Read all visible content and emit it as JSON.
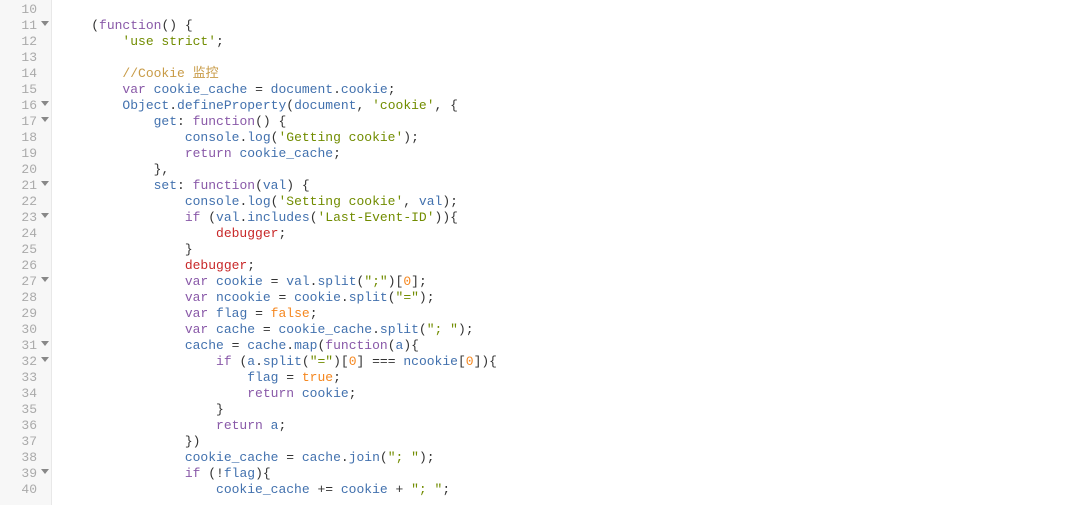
{
  "gutter": {
    "start": 10,
    "end": 40,
    "folds": [
      11,
      16,
      17,
      21,
      23,
      27,
      31,
      32,
      39
    ]
  },
  "indent_unit": "    ",
  "lines": [
    {
      "n": 10,
      "i": 0,
      "t": []
    },
    {
      "n": 11,
      "i": 1,
      "t": [
        {
          "c": "pun",
          "s": "("
        },
        {
          "c": "kw",
          "s": "function"
        },
        {
          "c": "pun",
          "s": "() {"
        }
      ]
    },
    {
      "n": 12,
      "i": 2,
      "t": [
        {
          "c": "str",
          "s": "'use strict'"
        },
        {
          "c": "pun",
          "s": ";"
        }
      ]
    },
    {
      "n": 13,
      "i": 0,
      "t": []
    },
    {
      "n": 14,
      "i": 2,
      "t": [
        {
          "c": "cmt",
          "s": "//Cookie 监控"
        }
      ]
    },
    {
      "n": 15,
      "i": 2,
      "t": [
        {
          "c": "kw",
          "s": "var"
        },
        {
          "c": "pun",
          "s": " "
        },
        {
          "c": "ident",
          "s": "cookie_cache"
        },
        {
          "c": "pun",
          "s": " = "
        },
        {
          "c": "ident",
          "s": "document"
        },
        {
          "c": "pun",
          "s": "."
        },
        {
          "c": "ident",
          "s": "cookie"
        },
        {
          "c": "pun",
          "s": ";"
        }
      ]
    },
    {
      "n": 16,
      "i": 2,
      "t": [
        {
          "c": "ident",
          "s": "Object"
        },
        {
          "c": "pun",
          "s": "."
        },
        {
          "c": "ident",
          "s": "defineProperty"
        },
        {
          "c": "pun",
          "s": "("
        },
        {
          "c": "ident",
          "s": "document"
        },
        {
          "c": "pun",
          "s": ", "
        },
        {
          "c": "str",
          "s": "'cookie'"
        },
        {
          "c": "pun",
          "s": ", {"
        }
      ]
    },
    {
      "n": 17,
      "i": 3,
      "t": [
        {
          "c": "ident",
          "s": "get"
        },
        {
          "c": "pun",
          "s": ": "
        },
        {
          "c": "kw",
          "s": "function"
        },
        {
          "c": "pun",
          "s": "() {"
        }
      ]
    },
    {
      "n": 18,
      "i": 4,
      "t": [
        {
          "c": "ident",
          "s": "console"
        },
        {
          "c": "pun",
          "s": "."
        },
        {
          "c": "ident",
          "s": "log"
        },
        {
          "c": "pun",
          "s": "("
        },
        {
          "c": "str",
          "s": "'Getting cookie'"
        },
        {
          "c": "pun",
          "s": ");"
        }
      ]
    },
    {
      "n": 19,
      "i": 4,
      "t": [
        {
          "c": "kw",
          "s": "return"
        },
        {
          "c": "pun",
          "s": " "
        },
        {
          "c": "ident",
          "s": "cookie_cache"
        },
        {
          "c": "pun",
          "s": ";"
        }
      ]
    },
    {
      "n": 20,
      "i": 3,
      "t": [
        {
          "c": "pun",
          "s": "},"
        }
      ]
    },
    {
      "n": 21,
      "i": 3,
      "t": [
        {
          "c": "ident",
          "s": "set"
        },
        {
          "c": "pun",
          "s": ": "
        },
        {
          "c": "kw",
          "s": "function"
        },
        {
          "c": "pun",
          "s": "("
        },
        {
          "c": "ident",
          "s": "val"
        },
        {
          "c": "pun",
          "s": ") {"
        }
      ]
    },
    {
      "n": 22,
      "i": 4,
      "t": [
        {
          "c": "ident",
          "s": "console"
        },
        {
          "c": "pun",
          "s": "."
        },
        {
          "c": "ident",
          "s": "log"
        },
        {
          "c": "pun",
          "s": "("
        },
        {
          "c": "str",
          "s": "'Setting cookie'"
        },
        {
          "c": "pun",
          "s": ", "
        },
        {
          "c": "ident",
          "s": "val"
        },
        {
          "c": "pun",
          "s": ");"
        }
      ]
    },
    {
      "n": 23,
      "i": 4,
      "t": [
        {
          "c": "kw",
          "s": "if"
        },
        {
          "c": "pun",
          "s": " ("
        },
        {
          "c": "ident",
          "s": "val"
        },
        {
          "c": "pun",
          "s": "."
        },
        {
          "c": "ident",
          "s": "includes"
        },
        {
          "c": "pun",
          "s": "("
        },
        {
          "c": "str",
          "s": "'Last-Event-ID'"
        },
        {
          "c": "pun",
          "s": ")){"
        }
      ]
    },
    {
      "n": 24,
      "i": 5,
      "t": [
        {
          "c": "dbg",
          "s": "debugger"
        },
        {
          "c": "pun",
          "s": ";"
        }
      ]
    },
    {
      "n": 25,
      "i": 4,
      "t": [
        {
          "c": "pun",
          "s": "}"
        }
      ]
    },
    {
      "n": 26,
      "i": 4,
      "t": [
        {
          "c": "dbg",
          "s": "debugger"
        },
        {
          "c": "pun",
          "s": ";"
        }
      ]
    },
    {
      "n": 27,
      "i": 4,
      "t": [
        {
          "c": "kw",
          "s": "var"
        },
        {
          "c": "pun",
          "s": " "
        },
        {
          "c": "ident",
          "s": "cookie"
        },
        {
          "c": "pun",
          "s": " = "
        },
        {
          "c": "ident",
          "s": "val"
        },
        {
          "c": "pun",
          "s": "."
        },
        {
          "c": "ident",
          "s": "split"
        },
        {
          "c": "pun",
          "s": "("
        },
        {
          "c": "str",
          "s": "\";\""
        },
        {
          "c": "pun",
          "s": ")["
        },
        {
          "c": "num",
          "s": "0"
        },
        {
          "c": "pun",
          "s": "];"
        }
      ]
    },
    {
      "n": 28,
      "i": 4,
      "t": [
        {
          "c": "kw",
          "s": "var"
        },
        {
          "c": "pun",
          "s": " "
        },
        {
          "c": "ident",
          "s": "ncookie"
        },
        {
          "c": "pun",
          "s": " = "
        },
        {
          "c": "ident",
          "s": "cookie"
        },
        {
          "c": "pun",
          "s": "."
        },
        {
          "c": "ident",
          "s": "split"
        },
        {
          "c": "pun",
          "s": "("
        },
        {
          "c": "str",
          "s": "\"=\""
        },
        {
          "c": "pun",
          "s": ");"
        }
      ]
    },
    {
      "n": 29,
      "i": 4,
      "t": [
        {
          "c": "kw",
          "s": "var"
        },
        {
          "c": "pun",
          "s": " "
        },
        {
          "c": "ident",
          "s": "flag"
        },
        {
          "c": "pun",
          "s": " = "
        },
        {
          "c": "bool",
          "s": "false"
        },
        {
          "c": "pun",
          "s": ";"
        }
      ]
    },
    {
      "n": 30,
      "i": 4,
      "t": [
        {
          "c": "kw",
          "s": "var"
        },
        {
          "c": "pun",
          "s": " "
        },
        {
          "c": "ident",
          "s": "cache"
        },
        {
          "c": "pun",
          "s": " = "
        },
        {
          "c": "ident",
          "s": "cookie_cache"
        },
        {
          "c": "pun",
          "s": "."
        },
        {
          "c": "ident",
          "s": "split"
        },
        {
          "c": "pun",
          "s": "("
        },
        {
          "c": "str",
          "s": "\"; \""
        },
        {
          "c": "pun",
          "s": ");"
        }
      ]
    },
    {
      "n": 31,
      "i": 4,
      "t": [
        {
          "c": "ident",
          "s": "cache"
        },
        {
          "c": "pun",
          "s": " = "
        },
        {
          "c": "ident",
          "s": "cache"
        },
        {
          "c": "pun",
          "s": "."
        },
        {
          "c": "ident",
          "s": "map"
        },
        {
          "c": "pun",
          "s": "("
        },
        {
          "c": "kw",
          "s": "function"
        },
        {
          "c": "pun",
          "s": "("
        },
        {
          "c": "ident",
          "s": "a"
        },
        {
          "c": "pun",
          "s": "){"
        }
      ]
    },
    {
      "n": 32,
      "i": 5,
      "t": [
        {
          "c": "kw",
          "s": "if"
        },
        {
          "c": "pun",
          "s": " ("
        },
        {
          "c": "ident",
          "s": "a"
        },
        {
          "c": "pun",
          "s": "."
        },
        {
          "c": "ident",
          "s": "split"
        },
        {
          "c": "pun",
          "s": "("
        },
        {
          "c": "str",
          "s": "\"=\""
        },
        {
          "c": "pun",
          "s": ")["
        },
        {
          "c": "num",
          "s": "0"
        },
        {
          "c": "pun",
          "s": "] === "
        },
        {
          "c": "ident",
          "s": "ncookie"
        },
        {
          "c": "pun",
          "s": "["
        },
        {
          "c": "num",
          "s": "0"
        },
        {
          "c": "pun",
          "s": "]){"
        }
      ]
    },
    {
      "n": 33,
      "i": 6,
      "t": [
        {
          "c": "ident",
          "s": "flag"
        },
        {
          "c": "pun",
          "s": " = "
        },
        {
          "c": "bool",
          "s": "true"
        },
        {
          "c": "pun",
          "s": ";"
        }
      ]
    },
    {
      "n": 34,
      "i": 6,
      "t": [
        {
          "c": "kw",
          "s": "return"
        },
        {
          "c": "pun",
          "s": " "
        },
        {
          "c": "ident",
          "s": "cookie"
        },
        {
          "c": "pun",
          "s": ";"
        }
      ]
    },
    {
      "n": 35,
      "i": 5,
      "t": [
        {
          "c": "pun",
          "s": "}"
        }
      ]
    },
    {
      "n": 36,
      "i": 5,
      "t": [
        {
          "c": "kw",
          "s": "return"
        },
        {
          "c": "pun",
          "s": " "
        },
        {
          "c": "ident",
          "s": "a"
        },
        {
          "c": "pun",
          "s": ";"
        }
      ]
    },
    {
      "n": 37,
      "i": 4,
      "t": [
        {
          "c": "pun",
          "s": "})"
        }
      ]
    },
    {
      "n": 38,
      "i": 4,
      "t": [
        {
          "c": "ident",
          "s": "cookie_cache"
        },
        {
          "c": "pun",
          "s": " = "
        },
        {
          "c": "ident",
          "s": "cache"
        },
        {
          "c": "pun",
          "s": "."
        },
        {
          "c": "ident",
          "s": "join"
        },
        {
          "c": "pun",
          "s": "("
        },
        {
          "c": "str",
          "s": "\"; \""
        },
        {
          "c": "pun",
          "s": ");"
        }
      ]
    },
    {
      "n": 39,
      "i": 4,
      "t": [
        {
          "c": "kw",
          "s": "if"
        },
        {
          "c": "pun",
          "s": " (!"
        },
        {
          "c": "ident",
          "s": "flag"
        },
        {
          "c": "pun",
          "s": "){"
        }
      ]
    },
    {
      "n": 40,
      "i": 5,
      "t": [
        {
          "c": "ident",
          "s": "cookie_cache"
        },
        {
          "c": "pun",
          "s": " += "
        },
        {
          "c": "ident",
          "s": "cookie"
        },
        {
          "c": "pun",
          "s": " + "
        },
        {
          "c": "str",
          "s": "\"; \""
        },
        {
          "c": "pun",
          "s": ";"
        }
      ]
    }
  ]
}
